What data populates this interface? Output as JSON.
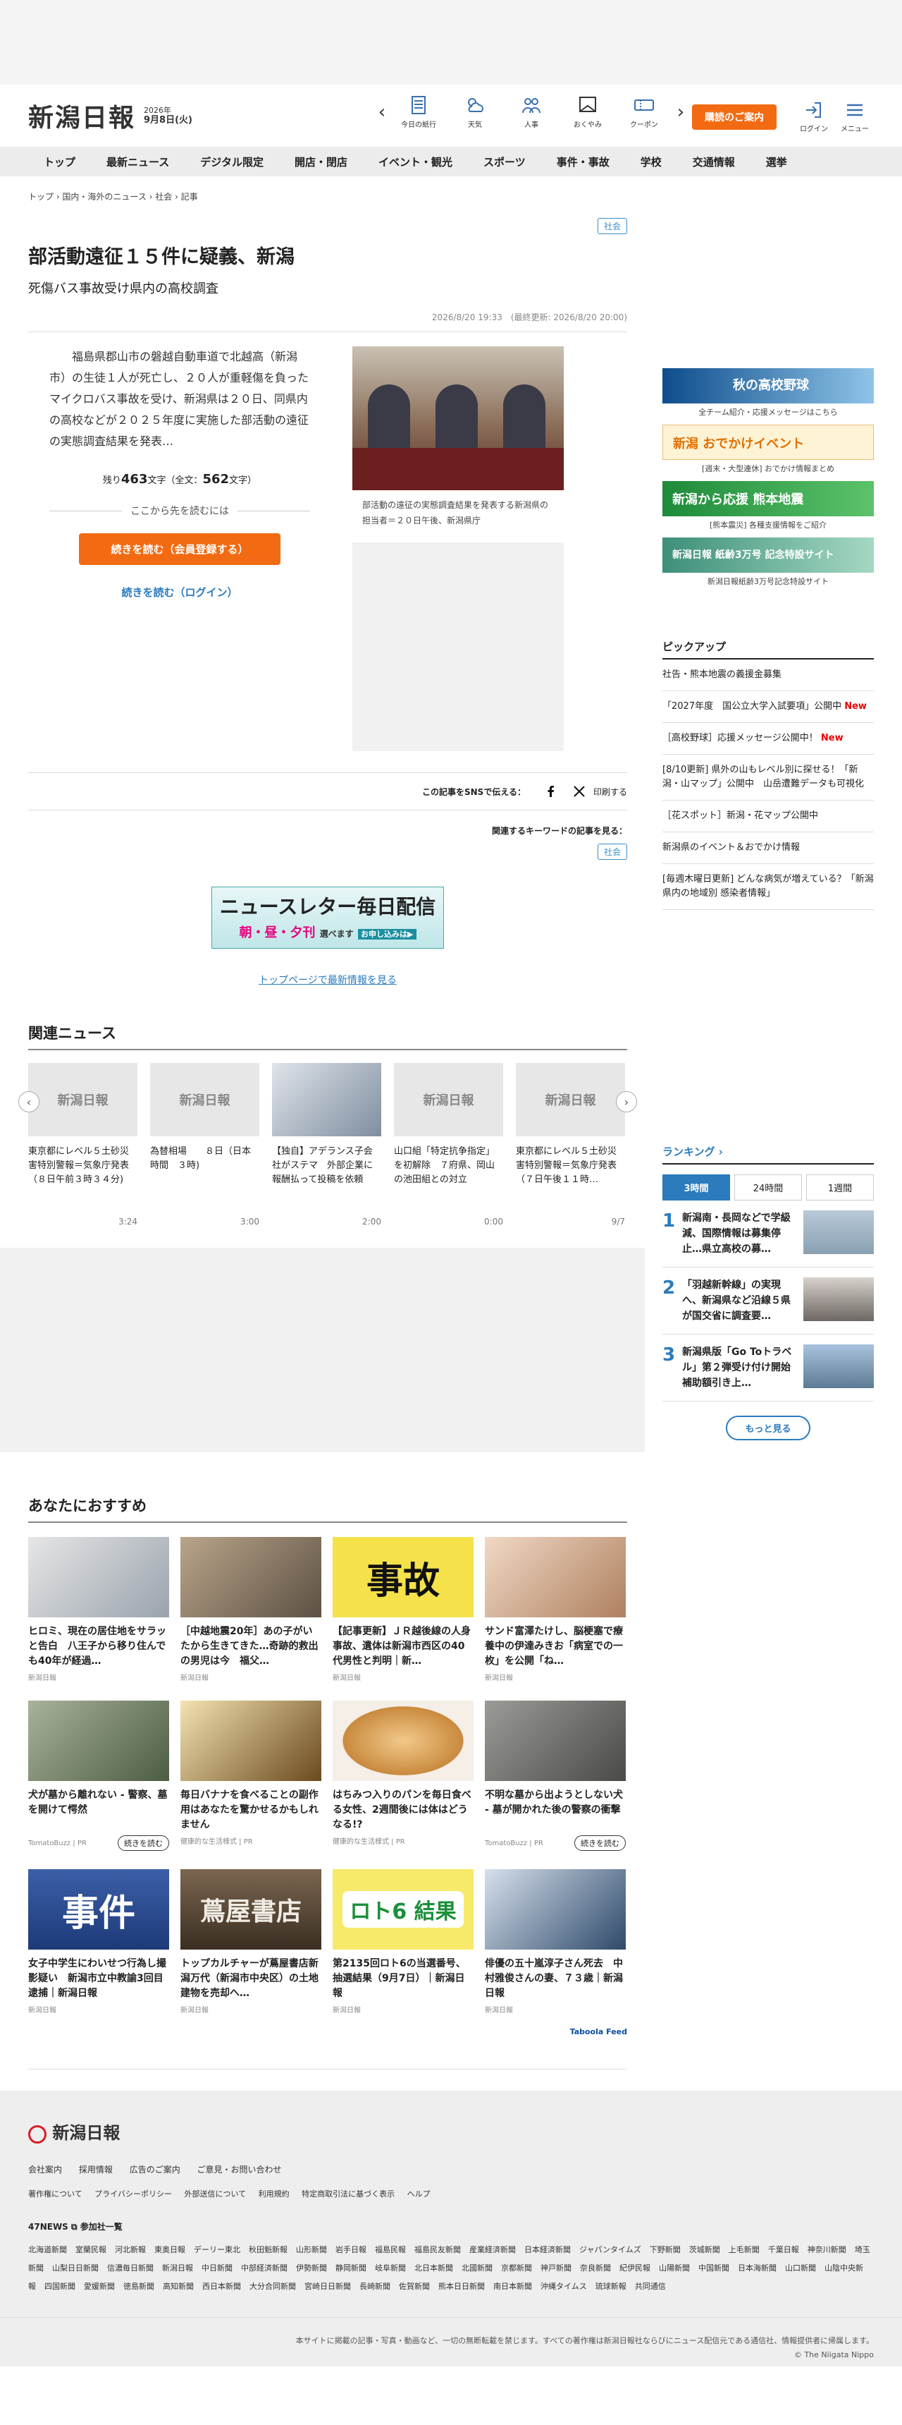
{
  "header": {
    "logo": "新潟日報",
    "year": "2026年",
    "month_day": "9月8日(火)",
    "icons": [
      "今日の紙行",
      "天気",
      "人事",
      "おくやみ",
      "クーポン"
    ],
    "subscribe": "購読のご案内",
    "login": "ログイン",
    "menu": "メニュー"
  },
  "nav": [
    "トップ",
    "最新ニュース",
    "デジタル限定",
    "開店・閉店",
    "イベント・観光",
    "スポーツ",
    "事件・事故",
    "学校",
    "交通情報",
    "選挙"
  ],
  "breadcrumb": "トップ › 国内・海外のニュース › 社会 › 記事",
  "article": {
    "category": "社会",
    "title": "部活動遠征１５件に疑義、新潟",
    "subtitle": "死傷バス事故受け県内の高校調査",
    "date": "2026/8/20 19:33　(最終更新: 2026/8/20 20:00)",
    "lead": "福島県郡山市の磐越自動車道で北越高（新潟市）の生徒１人が死亡し、２０人が重軽傷を負ったマイクロバス事故を受け、新潟県は２０日、同県内の高校などが２０２５年度に実施した部活動の遠征の実態調査結果を発表…",
    "remain_pre": "残り",
    "remain_count": "463",
    "remain_post": "文字（全文：",
    "total_count": "562",
    "total_post": "文字）",
    "divider": "ここから先を読むには",
    "read_member": "続きを読む（会員登録する）",
    "read_login": "続きを読む（ログイン）",
    "caption": "部活動の遠征の実態調査結果を発表する新潟県の担当者＝２０日午後、新潟県庁",
    "sns_label": "この記事をSNSで伝える：",
    "print": "印刷する",
    "keyword_label": "関連するキーワードの記事を見る：",
    "keyword_tag": "社会"
  },
  "newsletter": {
    "line1": "ニュースレター毎日配信",
    "line2": "朝・昼・夕刊",
    "line3": "選べます",
    "line4": "お申し込みは▶"
  },
  "top_link": "トップページで最新情報を見る",
  "related": {
    "title": "関連ニュース",
    "items": [
      {
        "thumb": "新潟日報",
        "title": "東京都にレベル５土砂災害特別警報＝気象庁発表（８日午前３時３４分)",
        "time": "3:24"
      },
      {
        "thumb": "新潟日報",
        "title": "為替相場　　８日（日本時間　３時)",
        "time": "3:00"
      },
      {
        "thumb": "",
        "title": "【独自】アデランス子会社がステマ　外部企業に報酬払って投稿を依頼",
        "time": "2:00"
      },
      {
        "thumb": "新潟日報",
        "title": "山口組「特定抗争指定」を初解除　７府県、岡山の池田組との対立",
        "time": "0:00"
      },
      {
        "thumb": "新潟日報",
        "title": "東京都にレベル５土砂災害特別警報＝気象庁発表（７日午後１１時…",
        "time": "9/7"
      }
    ]
  },
  "sidebar": {
    "banners": [
      {
        "text": "秋の高校野球",
        "cap": "全チーム紹介・応援メッセージはこちら"
      },
      {
        "text": "新潟 おでかけイベント",
        "cap": "[週末・大型連休] おでかけ情報まとめ"
      },
      {
        "text": "新潟から応援 熊本地震",
        "cap": "[熊本震災] 各種支援情報をご紹介"
      },
      {
        "text": "新潟日報 紙齢3万号 記念特設サイト",
        "cap": "新潟日報紙齢3万号記念特設サイト"
      }
    ],
    "pickup_title": "ピックアップ",
    "pickup": [
      {
        "text": "社告・熊本地震の義援金募集",
        "new": ""
      },
      {
        "text": "「2027年度　国公立大学入試要項」公開中",
        "new": "New"
      },
      {
        "text": "［高校野球］応援メッセージ公開中！",
        "new": "New"
      },
      {
        "text": "[8/10更新] 県外の山もレベル別に探せる！「新潟・山マップ」公開中　山岳遭難データも可視化",
        "new": ""
      },
      {
        "text": "［花スポット］新潟・花マップ公開中",
        "new": ""
      },
      {
        "text": "新潟県のイベント＆おでかけ情報",
        "new": ""
      },
      {
        "text": "[毎週木曜日更新] どんな病気が増えている？「新潟県内の地域別 感染者情報」",
        "new": ""
      }
    ],
    "ranking_title": "ランキング ›",
    "tabs": [
      "3時間",
      "24時間",
      "1週間"
    ],
    "ranking": [
      {
        "num": "1",
        "text": "新潟南・長岡などで学級減、国際情報は募集停止…県立高校の募…"
      },
      {
        "num": "2",
        "text": "「羽越新幹線」の実現へ、新潟県など沿線５県が国交省に調査要…"
      },
      {
        "num": "3",
        "text": "新潟県版「Go Toトラベル」第２弾受け付け開始　補助額引き上…"
      }
    ],
    "more": "もっと見る"
  },
  "reco": {
    "title": "あなたにおすすめ",
    "items": [
      {
        "title": "ヒロミ、現在の居住地をサラッと告白　八王子から移り住んでも40年が経過…",
        "src": "新潟日報",
        "more": "",
        "thumb": "person"
      },
      {
        "title": "［中越地震20年］あの子がいたから生きてきた…奇跡的救出の男児は今　福父…",
        "src": "新潟日報",
        "more": "",
        "thumb": "rescue"
      },
      {
        "title": "【記事更新】ＪＲ越後線の人身事故、遺体は新潟市西区の40代男性と判明｜新…",
        "src": "新潟日報",
        "more": "",
        "thumb": "jiko",
        "label": "事故"
      },
      {
        "title": "サンド富澤たけし、脳梗塞で療養中の伊達みきお「病室での一枚」を公開「ね…",
        "src": "新潟日報",
        "more": "",
        "thumb": "people2"
      },
      {
        "title": "犬が墓から離れない - 警察、墓を開けて愕然",
        "src": "TomatoBuzz | PR",
        "more": "続きを読む",
        "thumb": "grave"
      },
      {
        "title": "毎日バナナを食べることの副作用はあなたを驚かせるかもしれません",
        "src": "健康的な生活様式 | PR",
        "more": "",
        "thumb": "banana"
      },
      {
        "title": "はちみつ入りのパンを毎日食べる女性、2週間後には体はどうなる!?",
        "src": "健康的な生活様式 | PR",
        "more": "",
        "thumb": "bread"
      },
      {
        "title": "不明な墓から出ようとしない犬 - 墓が開かれた後の警察の衝撃",
        "src": "TomatoBuzz | PR",
        "more": "続きを読む",
        "thumb": "dog"
      },
      {
        "title": "女子中学生にわいせつ行為し撮影疑い　新潟市立中教諭3回目逮捕｜新潟日報",
        "src": "新潟日報",
        "more": "",
        "thumb": "jiken",
        "label": "事件"
      },
      {
        "title": "トップカルチャーが蔦屋書店新潟万代（新潟市中央区）の土地建物を売却へ…",
        "src": "新潟日報",
        "more": "",
        "thumb": "store",
        "label": "蔦屋書店"
      },
      {
        "title": "第2135回ロト6の当選番号、抽選結果（9月7日）｜新潟日報",
        "src": "新潟日報",
        "more": "",
        "thumb": "loto",
        "label": "ロト6 結果"
      },
      {
        "title": "俳優の五十嵐淳子さん死去　中村雅俊さんの妻、７３歳｜新潟日報",
        "src": "新潟日報",
        "more": "",
        "thumb": "woman"
      }
    ],
    "taboola": "Taboola Feed"
  },
  "footer": {
    "logo": "新潟日報",
    "links1": [
      "会社案内",
      "採用情報",
      "広告のご案内",
      "ご意見・お問い合わせ"
    ],
    "links2": [
      "著作権について",
      "プライバシーポリシー",
      "外部送信について",
      "利用規約",
      "特定商取引法に基づく表示",
      "ヘルプ"
    ],
    "news47": "47NEWS ⧉ 参加社一覧",
    "papers": [
      "北海道新聞",
      "室蘭民報",
      "河北新報",
      "東奥日報",
      "デーリー東北",
      "秋田魁新報",
      "山形新聞",
      "岩手日報",
      "福島民報",
      "福島民友新聞",
      "産業経済新聞",
      "日本経済新聞",
      "ジャパンタイムズ",
      "下野新聞",
      "茨城新聞",
      "上毛新聞",
      "千葉日報",
      "神奈川新聞",
      "埼玉新聞",
      "山梨日日新聞",
      "信濃毎日新聞",
      "新潟日報",
      "中日新聞",
      "中部経済新聞",
      "伊勢新聞",
      "静岡新聞",
      "岐阜新聞",
      "北日本新聞",
      "北國新聞",
      "京都新聞",
      "神戸新聞",
      "奈良新聞",
      "紀伊民報",
      "山陽新聞",
      "中国新聞",
      "日本海新聞",
      "山口新聞",
      "山陰中央新報",
      "四国新聞",
      "愛媛新聞",
      "徳島新聞",
      "高知新聞",
      "西日本新聞",
      "大分合同新聞",
      "宮崎日日新聞",
      "長崎新聞",
      "佐賀新聞",
      "熊本日日新聞",
      "南日本新聞",
      "沖縄タイムス",
      "琉球新報",
      "共同通信"
    ],
    "copyright_note": "本サイトに掲載の記事・写真・動画など、一切の無断転載を禁じます。すべての著作権は新潟日報社ならびにニュース配信元である通信社、情報提供者に帰属します。",
    "copyright": "© The Niigata Nippo"
  },
  "colors": {
    "accent": "#f26b12",
    "link": "#2b7bbd",
    "new": "#e00000"
  }
}
